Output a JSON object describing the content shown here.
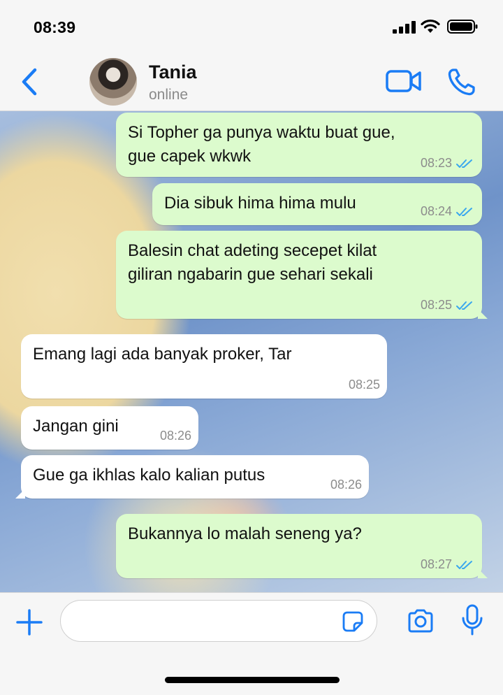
{
  "status_bar": {
    "time": "08:39"
  },
  "header": {
    "contact_name": "Tania",
    "contact_status": "online"
  },
  "messages": [
    {
      "direction": "out",
      "text": "Si Topher ga punya waktu buat gue,\ngue capek wkwk",
      "time": "08:23",
      "read": true
    },
    {
      "direction": "out",
      "text": "Dia sibuk hima hima mulu",
      "time": "08:24",
      "read": true
    },
    {
      "direction": "out",
      "text": "Balesin chat adeting secepet kilat\ngiliran ngabarin gue sehari sekali",
      "time": "08:25",
      "read": true
    },
    {
      "direction": "in",
      "text": "Emang lagi ada banyak proker, Tar",
      "time": "08:25"
    },
    {
      "direction": "in",
      "text": "Jangan gini",
      "time": "08:26"
    },
    {
      "direction": "in",
      "text": "Gue ga ikhlas kalo kalian putus",
      "time": "08:26"
    },
    {
      "direction": "out",
      "text": "Bukannya lo malah seneng ya?",
      "time": "08:27",
      "read": true
    }
  ],
  "input": {
    "value": "",
    "placeholder": ""
  },
  "colors": {
    "accent": "#1a7cf5",
    "outgoing_bubble": "#dcfbcd",
    "incoming_bubble": "#ffffff",
    "read_ticks": "#3aa7ee"
  },
  "icons": [
    "back-icon",
    "video-call-icon",
    "phone-icon",
    "plus-icon",
    "sticker-icon",
    "camera-icon",
    "mic-icon"
  ]
}
